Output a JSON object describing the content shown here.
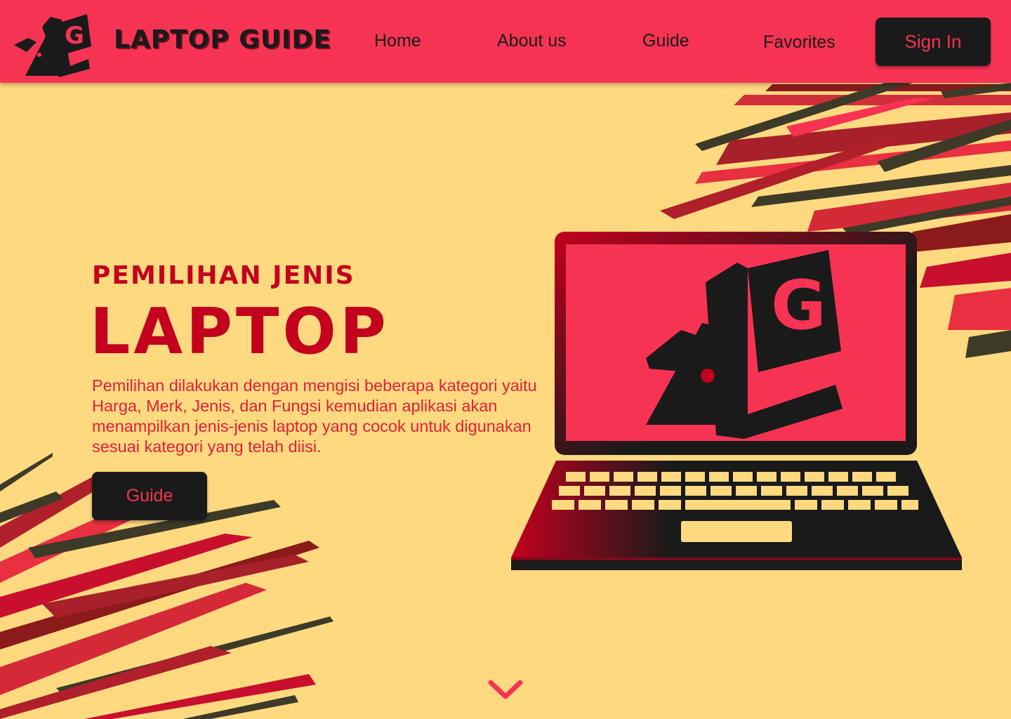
{
  "colors": {
    "navbar_bg": "#F73353",
    "page_bg": "#FFD980",
    "button_bg": "#1A1A1A",
    "button_text": "#F73353",
    "accent_red": "#C3001E"
  },
  "header": {
    "logo_icon": "lg-logo-icon",
    "brand": "LAPTOP GUIDE",
    "nav": {
      "home": "Home",
      "about": "About us",
      "guide": "Guide",
      "favorites": "Favorites"
    },
    "sign_in": "Sign In"
  },
  "hero": {
    "subtitle": "PEMILIHAN JENIS",
    "title": "LAPTOP",
    "description": "Pemilihan dilakukan dengan mengisi beberapa kategori yaitu Harga, Merk, Jenis, dan Fungsi kemudian aplikasi akan menampilkan jenis-jenis laptop yang cocok untuk digunakan sesuai kategori yang telah diisi.",
    "button": "Guide",
    "illustration_icon": "laptop-illustration",
    "scroll_icon": "chevron-down-icon"
  }
}
